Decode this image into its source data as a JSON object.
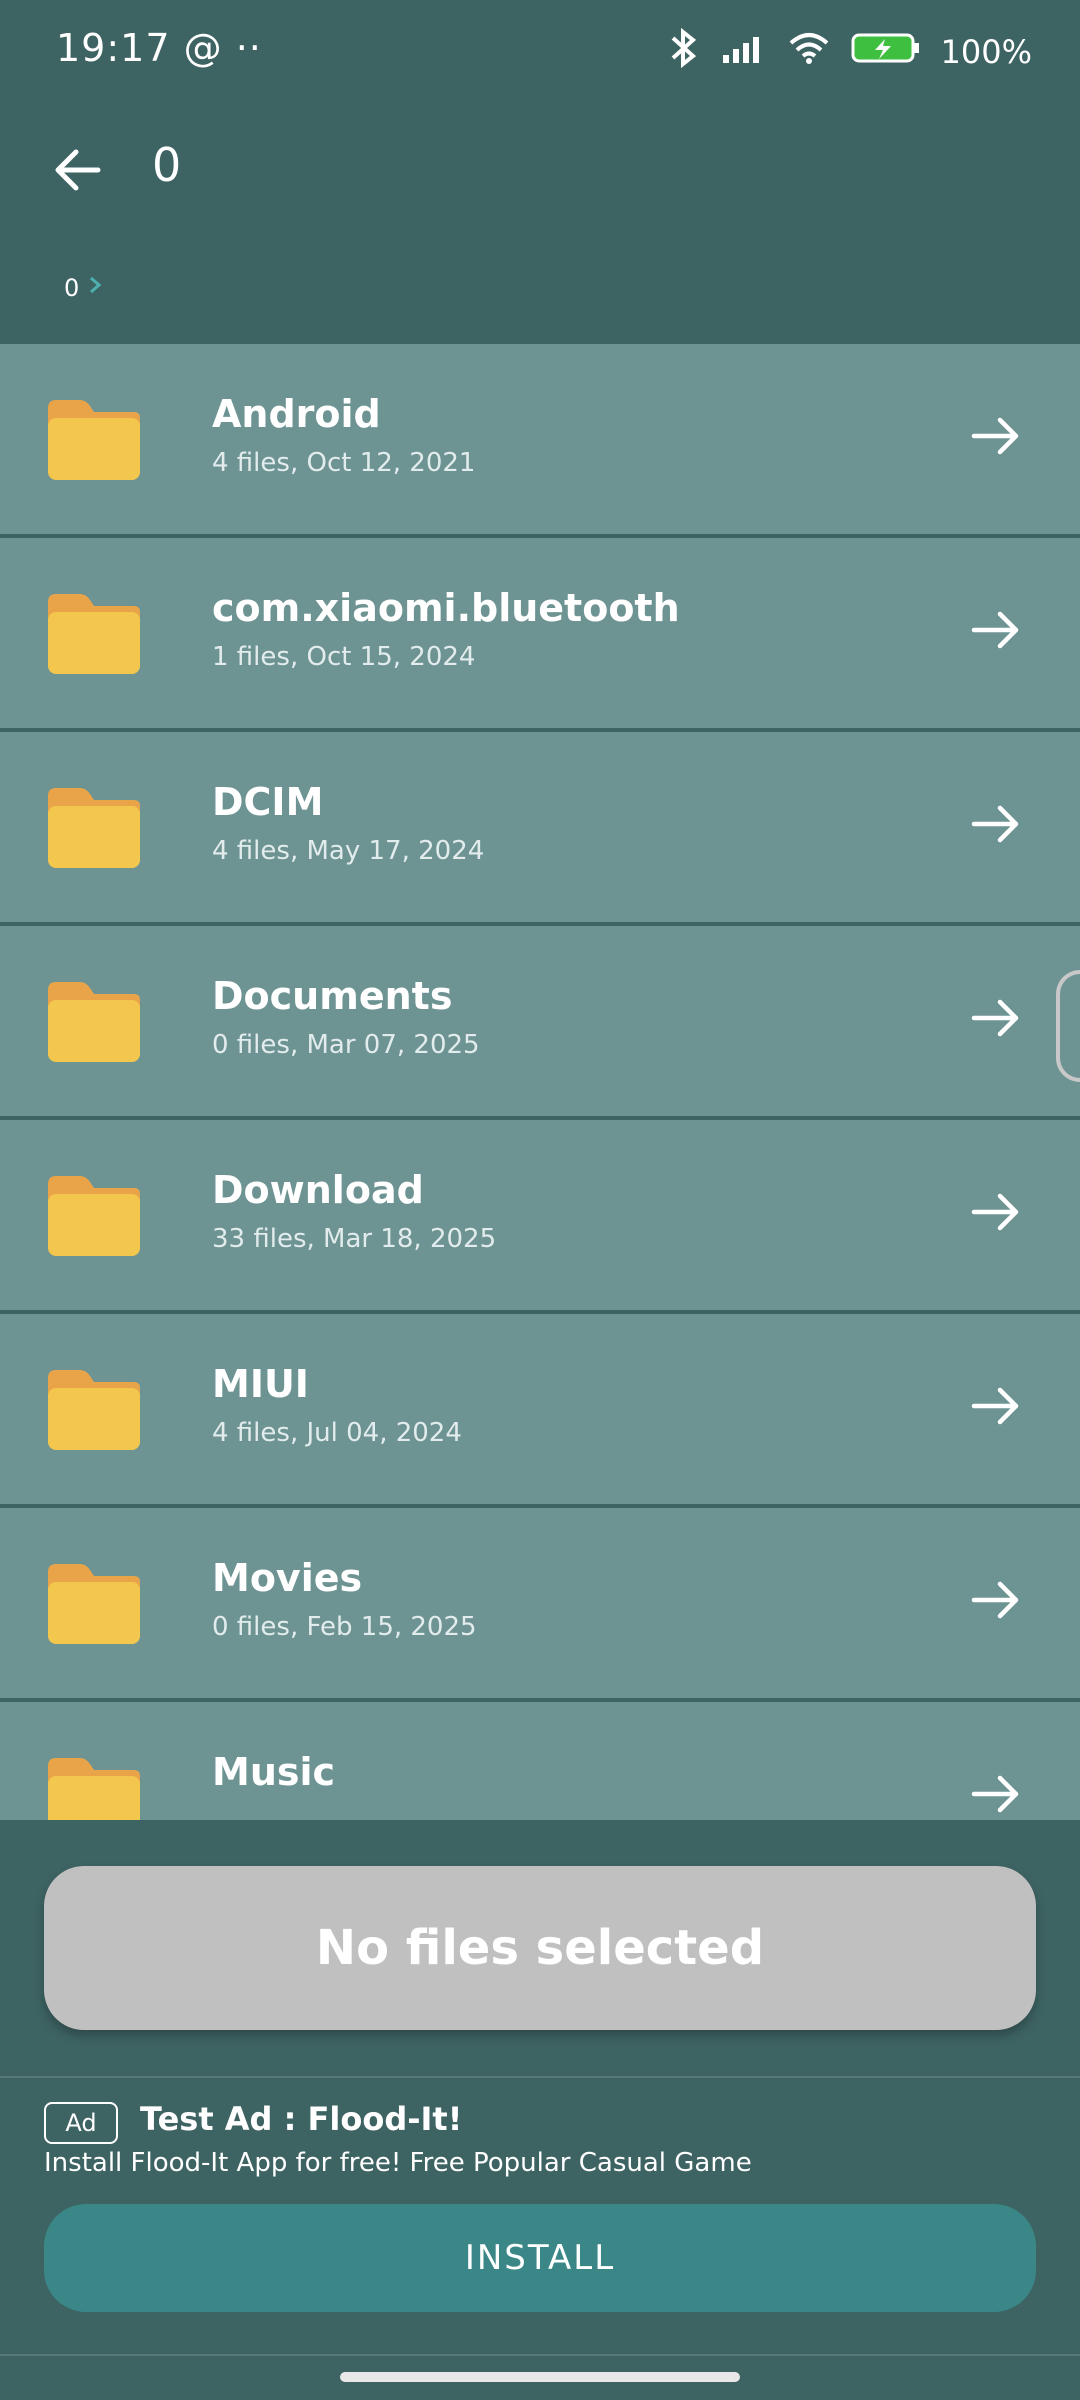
{
  "status_bar": {
    "time": "19:17",
    "extra": "@ ··",
    "battery": "100%"
  },
  "header": {
    "title": "0",
    "breadcrumb": "0"
  },
  "folders": [
    {
      "name": "Android",
      "meta": "4 files, Oct 12, 2021"
    },
    {
      "name": "com.xiaomi.bluetooth",
      "meta": "1 files, Oct 15, 2024"
    },
    {
      "name": "DCIM",
      "meta": "4 files, May 17, 2024"
    },
    {
      "name": "Documents",
      "meta": "0 files, Mar 07, 2025"
    },
    {
      "name": "Download",
      "meta": "33 files, Mar 18, 2025"
    },
    {
      "name": "MIUI",
      "meta": "4 files, Jul 04, 2024"
    },
    {
      "name": "Movies",
      "meta": "0 files, Feb 15, 2025"
    },
    {
      "name": "Music",
      "meta": ""
    }
  ],
  "action": {
    "label": "No files selected"
  },
  "ad": {
    "badge": "Ad",
    "title": "Test Ad : Flood-It!",
    "description": "Install Flood-It App for free! Free Popular Casual Game",
    "button": "INSTALL"
  },
  "colors": {
    "background": "#3e6363",
    "row": "#6e9393",
    "folder": "#f3c64e",
    "folder_tab": "#e9a44a",
    "install": "#3b8788"
  }
}
